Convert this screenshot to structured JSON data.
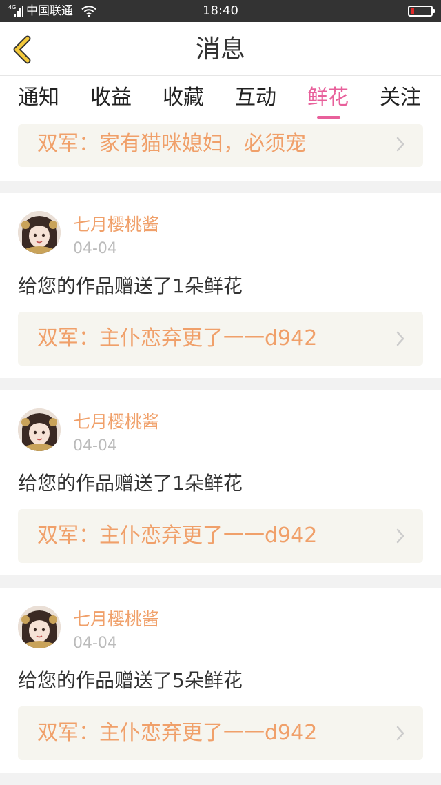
{
  "status_bar": {
    "network": "4G",
    "carrier": "中国联通",
    "time": "18:40"
  },
  "header": {
    "title": "消息",
    "back_icon": "chevron-left-icon"
  },
  "tabs": [
    {
      "label": "通知",
      "active": false
    },
    {
      "label": "收益",
      "active": false
    },
    {
      "label": "收藏",
      "active": false
    },
    {
      "label": "互动",
      "active": false
    },
    {
      "label": "鲜花",
      "active": true
    },
    {
      "label": "关注",
      "active": false
    }
  ],
  "top_partial_card": {
    "link_text": "双军：家有猫咪媳妇，必须宠"
  },
  "messages": [
    {
      "user": "七月樱桃酱",
      "date": "04-04",
      "text": "给您的作品赠送了1朵鲜花",
      "link_text": "双军：主仆恋弃更了一一d942"
    },
    {
      "user": "七月樱桃酱",
      "date": "04-04",
      "text": "给您的作品赠送了1朵鲜花",
      "link_text": "双军：主仆恋弃更了一一d942"
    },
    {
      "user": "七月樱桃酱",
      "date": "04-04",
      "text": "给您的作品赠送了5朵鲜花",
      "link_text": "双军：主仆恋弃更了一一d942"
    }
  ],
  "colors": {
    "accent": "#e8609b",
    "link": "#f0a06a",
    "status_bar": "#333333",
    "back_arrow": "#f3c93b"
  }
}
